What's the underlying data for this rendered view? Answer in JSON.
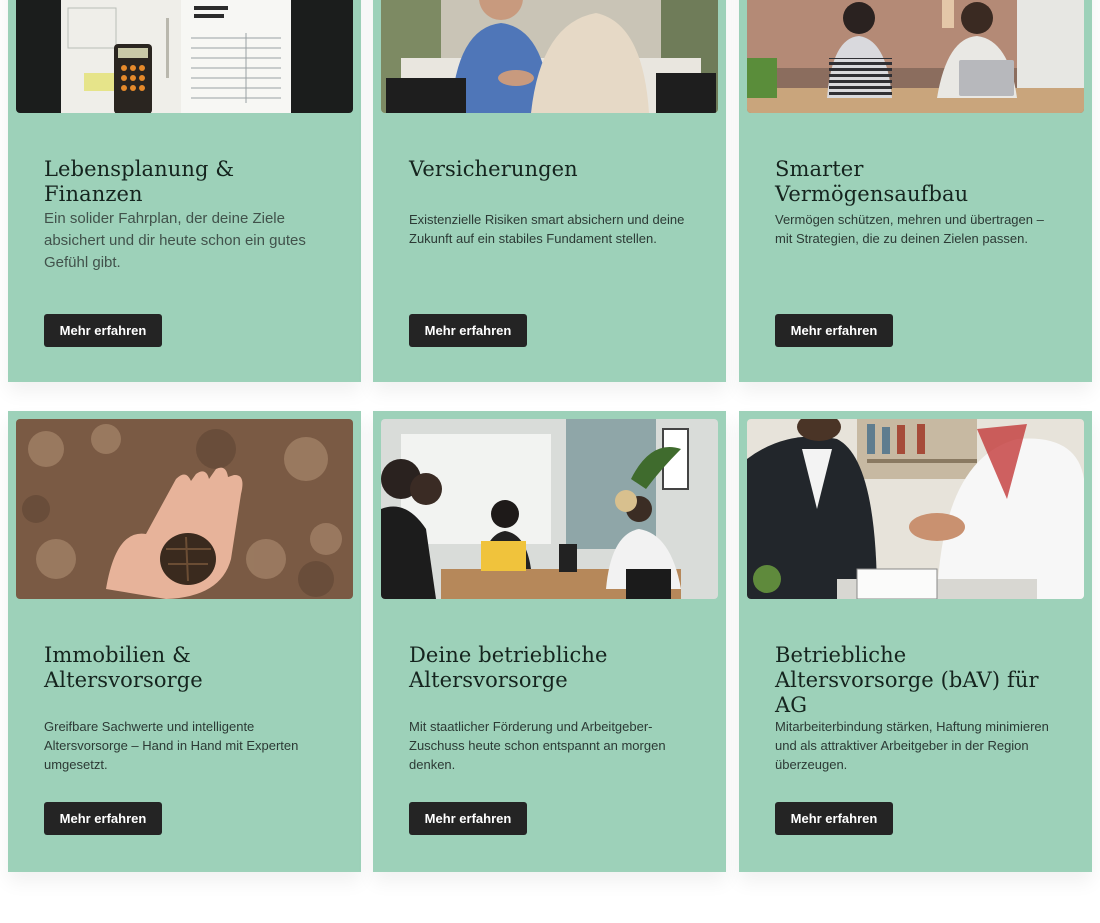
{
  "cards": [
    {
      "title": "Lebensplanung & Finanzen",
      "text": "Ein solider Fahrplan, der deine Ziele absichert und dir heute schon ein gutes Gefühl gibt.",
      "button": "Mehr erfahren"
    },
    {
      "title": "Versicherungen",
      "text": "Existenzielle Risiken smart absichern und deine Zukunft auf ein stabiles Fundament stellen.",
      "button": "Mehr erfahren"
    },
    {
      "title": "Smarter Vermögensaufbau",
      "text": "Vermögen schützen, mehren und übertragen – mit Strategien, die zu deinen Zielen passen.",
      "button": "Mehr erfahren"
    },
    {
      "title": "Immobilien & Altersvorsorge",
      "text": "Greifbare Sachwerte und intelligente Altersvorsorge – Hand in Hand mit Experten umgesetzt.",
      "button": "Mehr erfahren"
    },
    {
      "title": "Deine betriebliche Altersvorsorge",
      "text": "Mit staatlicher Förderung und Arbeitgeber-Zuschuss heute schon entspannt an morgen denken.",
      "button": "Mehr erfahren"
    },
    {
      "title": "Betriebliche Altersvorsorge (bAV) für AG",
      "text": "Mitarbeiterbindung stärken, Haftung minimieren und als attraktiver Arbeitgeber in der Region überzeugen.",
      "button": "Mehr erfahren"
    }
  ],
  "images": [
    {
      "icon": "tax-documents-calculator-photo"
    },
    {
      "icon": "business-meeting-photo"
    },
    {
      "icon": "high-five-office-photo"
    },
    {
      "icon": "hand-holding-pinecone-photo"
    },
    {
      "icon": "team-meeting-laptops-photo"
    },
    {
      "icon": "handshake-office-photo"
    }
  ],
  "colors": {
    "card_bg": "#9dd1b9",
    "button_bg": "#242424",
    "button_text": "#ffffff"
  }
}
